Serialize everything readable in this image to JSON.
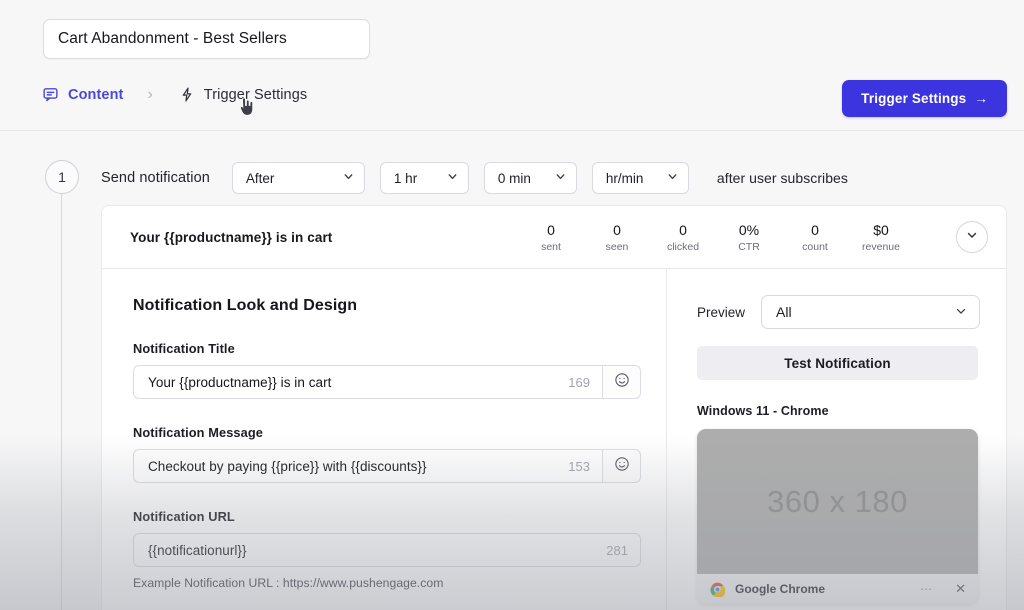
{
  "header": {
    "campaign_name": "Cart Abandonment - Best Sellers",
    "breadcrumb": {
      "content_label": "Content",
      "content_icon": "message-bubble-icon",
      "separator": "›",
      "trigger_label": "Trigger Settings",
      "trigger_icon": "lightning-bolt-icon"
    },
    "trigger_settings_button": "Trigger Settings",
    "trigger_settings_button_arrow": "→",
    "accent_color": "#3c34de"
  },
  "step": {
    "number": "1",
    "send_notification_label": "Send notification",
    "selects": [
      {
        "name": "timing",
        "value": "After"
      },
      {
        "name": "hours",
        "value": "1 hr"
      },
      {
        "name": "minutes",
        "value": "0 min"
      },
      {
        "name": "unit",
        "value": "hr/min"
      }
    ],
    "after_text": "after user subscribes"
  },
  "stats": {
    "title": "Your {{productname}} is in cart",
    "metrics": [
      {
        "value": "0",
        "label": "sent"
      },
      {
        "value": "0",
        "label": "seen"
      },
      {
        "value": "0",
        "label": "clicked"
      },
      {
        "value": "0%",
        "label": "CTR"
      },
      {
        "value": "0",
        "label": "count"
      },
      {
        "value": "$0",
        "label": "revenue"
      }
    ],
    "collapse_icon": "chevron-down-icon"
  },
  "form": {
    "section_title": "Notification Look and Design",
    "title_field": {
      "label": "Notification Title",
      "value": "Your {{productname}} is in cart",
      "counter": "169",
      "emoji_icon": "smiley-face-icon"
    },
    "message_field": {
      "label": "Notification Message",
      "value": "Checkout by paying {{price}} with {{discounts}}",
      "counter": "153",
      "emoji_icon": "smiley-face-icon"
    },
    "url_field": {
      "label": "Notification URL",
      "value": "{{notificationurl}}",
      "counter": "281"
    },
    "url_hint": "Example Notification URL : https://www.pushengage.com"
  },
  "preview": {
    "label": "Preview",
    "select_value": "All",
    "select_icon": "chevron-down-icon",
    "test_button": "Test Notification",
    "platform_label": "Windows 11 - Chrome",
    "image_placeholder": "360 x 180",
    "notification_app": "Google Chrome",
    "notification_app_icon": "chrome-icon",
    "more_options_icon": "ellipsis-icon",
    "close_icon": "close-icon"
  }
}
